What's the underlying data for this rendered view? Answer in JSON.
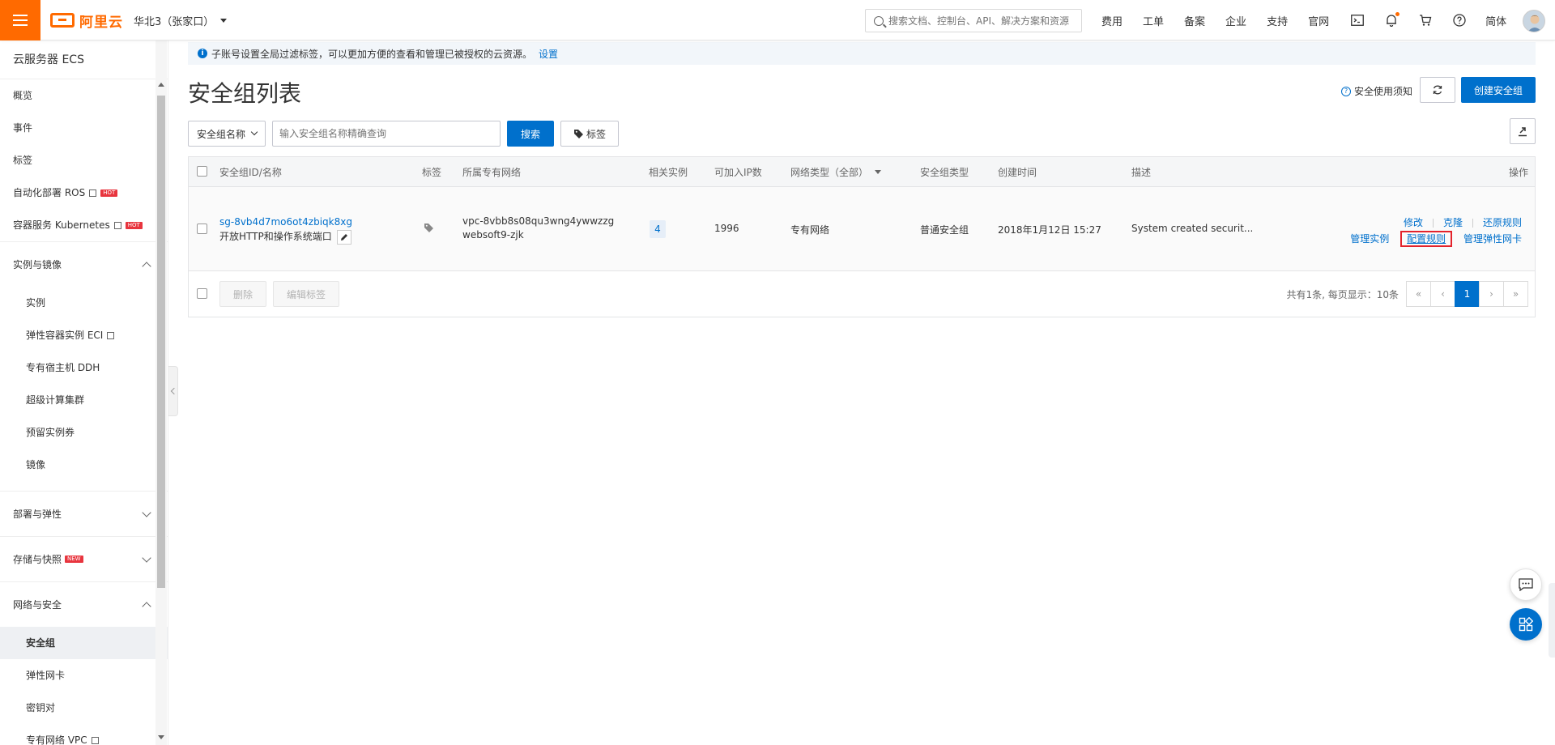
{
  "topbar": {
    "logo_text": "阿里云",
    "region": "华北3（张家口）",
    "search_placeholder": "搜索文档、控制台、API、解决方案和资源",
    "nav": [
      "费用",
      "工单",
      "备案",
      "企业",
      "支持",
      "官网"
    ],
    "lang": "简体",
    "brand_color": "#ff6a00"
  },
  "sidebar": {
    "title": "云服务器 ECS",
    "top_items": [
      {
        "label": "概览"
      },
      {
        "label": "事件"
      },
      {
        "label": "标签"
      },
      {
        "label": "自动化部署 ROS",
        "badge": "HOT"
      },
      {
        "label": "容器服务 Kubernetes",
        "badge": "HOT"
      }
    ],
    "group_instances": {
      "label": "实例与镜像",
      "items": [
        "实例",
        "弹性容器实例 ECI",
        "专有宿主机 DDH",
        "超级计算集群",
        "预留实例券",
        "镜像"
      ]
    },
    "group_deploy": {
      "label": "部署与弹性"
    },
    "group_storage": {
      "label": "存储与快照",
      "badge": "NEW"
    },
    "group_network": {
      "label": "网络与安全",
      "items": [
        "安全组",
        "弹性网卡",
        "密钥对",
        "专有网络 VPC"
      ]
    }
  },
  "notice": {
    "text": "子账号设置全局过滤标签，可以更加方便的查看和管理已被授权的云资源。",
    "link": "设置"
  },
  "page": {
    "title": "安全组列表",
    "help": "安全使用须知",
    "create_button": "创建安全组"
  },
  "filter": {
    "select": "安全组名称",
    "placeholder": "输入安全组名称精确查询",
    "search_button": "搜索",
    "tag_button": "标签"
  },
  "table": {
    "columns": [
      "安全组ID/名称",
      "标签",
      "所属专有网络",
      "相关实例",
      "可加入IP数",
      "网络类型（全部）",
      "安全组类型",
      "创建时间",
      "描述",
      "操作"
    ],
    "rows": [
      {
        "id": "sg-8vb4d7mo6ot4zbiqk8xg",
        "name": "开放HTTP和操作系统端口",
        "vpc_id": "vpc-8vbb8s08qu3wng4ywwzzg",
        "vpc_name": "websoft9-zjk",
        "instances": "4",
        "ip_count": "1996",
        "net_type": "专有网络",
        "sg_type": "普通安全组",
        "created": "2018年1月12日 15:27",
        "desc": "System created securit...",
        "ops_line1": [
          "修改",
          "克隆",
          "还原规则"
        ],
        "ops_line2": [
          "管理实例",
          "配置规则",
          "管理弹性网卡"
        ]
      }
    ]
  },
  "footer": {
    "delete": "删除",
    "edit_tags": "编辑标签",
    "summary": "共有1条, 每页显示：10条",
    "pages": [
      "«",
      "‹",
      "1",
      "›",
      "»"
    ]
  },
  "colors": {
    "accent": "#0070cc",
    "highlight_box": "#e3232c"
  }
}
